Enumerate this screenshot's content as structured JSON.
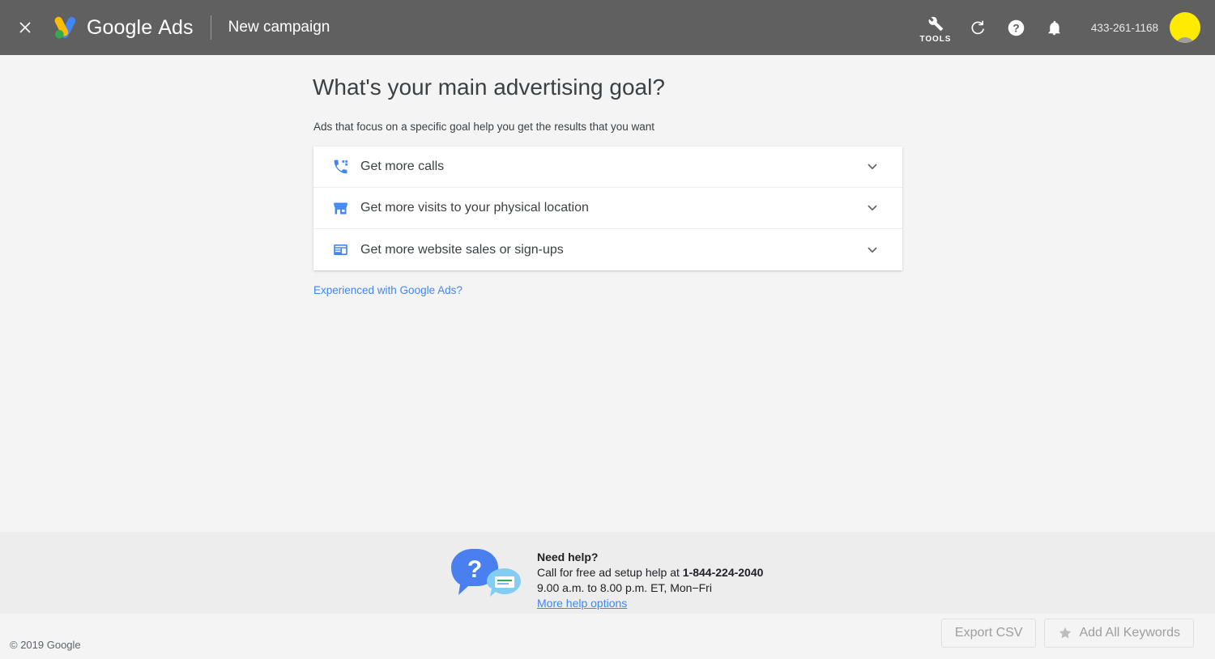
{
  "header": {
    "close_icon": "close-icon",
    "logo_icon": "google-ads-logo-icon",
    "brand_bold": "Google",
    "brand_light": "Ads",
    "page_context": "New campaign",
    "tools": {
      "icon": "wrench-icon",
      "label": "TOOLS"
    },
    "refresh_icon": "refresh-icon",
    "help_icon": "help-circle-icon",
    "notifications_icon": "bell-icon",
    "phone_number": "433-261-1168",
    "avatar": "account-avatar"
  },
  "main": {
    "headline": "What's your main advertising goal?",
    "subhead": "Ads that focus on a specific goal help you get the results that you want",
    "goals": [
      {
        "icon": "phone-calls-icon",
        "label": "Get more calls",
        "chevron": "chevron-down-icon"
      },
      {
        "icon": "storefront-icon",
        "label": "Get more visits to your physical location",
        "chevron": "chevron-down-icon"
      },
      {
        "icon": "web-page-icon",
        "label": "Get more website sales or sign-ups",
        "chevron": "chevron-down-icon"
      }
    ],
    "experienced_link": "Experienced with Google Ads?"
  },
  "help": {
    "bubble_icon": "help-chat-bubbles-icon",
    "title": "Need help?",
    "call_prefix": "Call for free ad setup help at ",
    "phone": "1-844-224-2040",
    "hours": "9.00 a.m. to 8.00 p.m. ET, Mon−Fri",
    "more_link": "More help options"
  },
  "footer": {
    "copyright": "© 2019 Google",
    "export_button": "Export CSV",
    "add_keywords_button": "Add All Keywords",
    "star_icon": "star-icon"
  },
  "colors": {
    "header_bg": "#606060",
    "page_bg": "#f4f4f4",
    "help_band_bg": "#ededed",
    "card_bg": "#ffffff",
    "accent_blue": "#4285f4",
    "avatar_yellow": "#ffeb00",
    "text_primary": "#3c4043"
  }
}
